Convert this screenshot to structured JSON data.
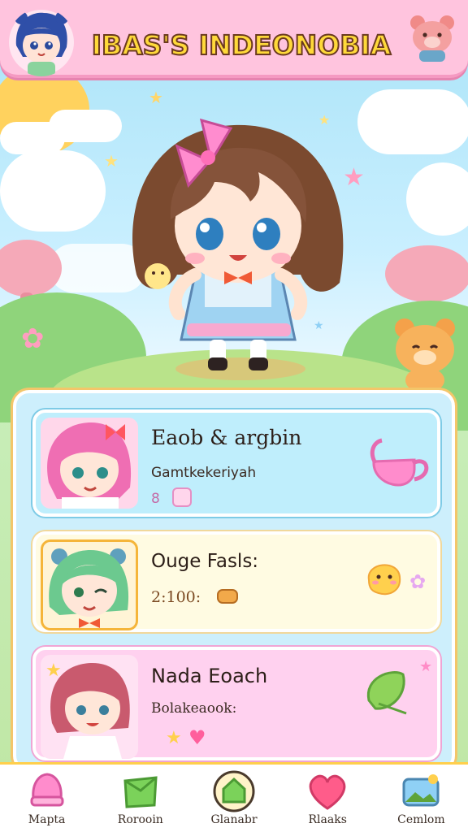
{
  "header": {
    "title": "IBAS'S INDEONOBIA",
    "avatar_icon": "girl-avatar-icon",
    "right_icon": "bear-icon"
  },
  "colors": {
    "header_bg": "#ffc4de",
    "title_fill": "#ffd93a",
    "panel_bg": "#cdeffc",
    "accent_gold": "#f3c66a"
  },
  "cards": [
    {
      "title": "Eaob & argbin",
      "subtitle": "Gamtkekeriyah",
      "meta": "8",
      "icon": "teapot-icon",
      "bg": "#bfeefc"
    },
    {
      "title": "Ouge Fasls:",
      "subtitle": "2:100:",
      "icon": "blob-face-icon",
      "bg": "#fffbe2"
    },
    {
      "title": "Nada Eoach",
      "subtitle": "Bolakeaook:",
      "icon": "leaf-icon",
      "bg": "#ffd1ef"
    }
  ],
  "nav": [
    {
      "label": "Mapta",
      "icon": "pot-icon"
    },
    {
      "label": "Rorooin",
      "icon": "green-box-icon"
    },
    {
      "label": "Glanabr",
      "icon": "house-icon"
    },
    {
      "label": "Rlaaks",
      "icon": "heart-icon"
    },
    {
      "label": "Cemlom",
      "icon": "picture-icon"
    }
  ]
}
